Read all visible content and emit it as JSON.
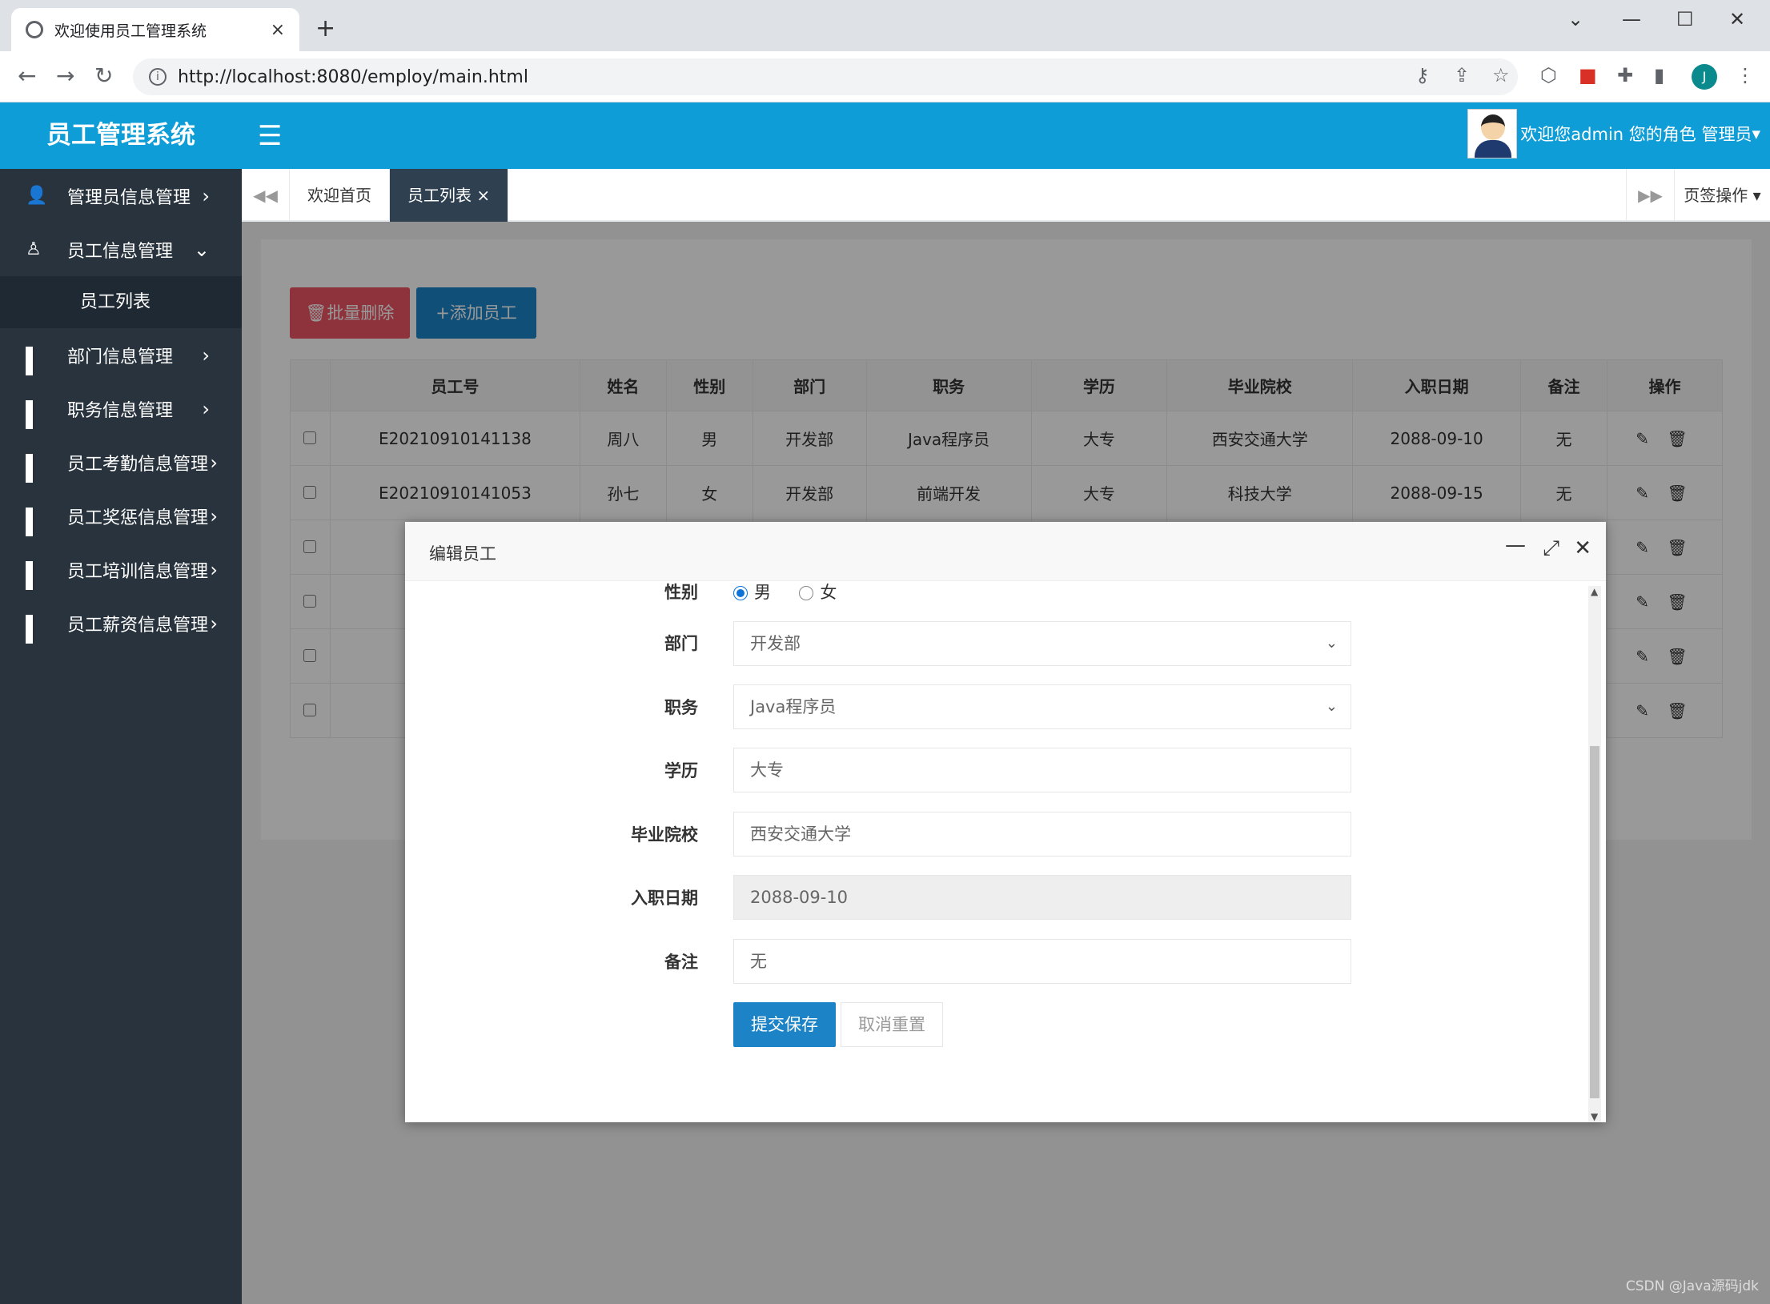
{
  "browser": {
    "tab_title": "欢迎使用员工管理系统",
    "tab_close": "×",
    "new_tab": "+",
    "url": "http://localhost:8080/employ/main.html",
    "profile_initial": "J"
  },
  "header": {
    "logo": "员工管理系统",
    "menu_toggle": "☰",
    "welcome": "欢迎您admin 您的角色 管理员"
  },
  "sidebar": {
    "items": [
      {
        "label": "管理员信息管理",
        "arrow": "›"
      },
      {
        "label": "员工信息管理",
        "arrow": "⌄"
      },
      {
        "label": "员工列表"
      },
      {
        "label": "部门信息管理",
        "arrow": "›"
      },
      {
        "label": "职务信息管理",
        "arrow": "›"
      },
      {
        "label": "员工考勤信息管理",
        "arrow": "›"
      },
      {
        "label": "员工奖惩信息管理",
        "arrow": "›"
      },
      {
        "label": "员工培训信息管理",
        "arrow": "›"
      },
      {
        "label": "员工薪资信息管理",
        "arrow": "›"
      }
    ]
  },
  "page_tabs": {
    "tabs": [
      {
        "label": "欢迎首页"
      },
      {
        "label": "员工列表",
        "close": "×"
      }
    ],
    "ops_label": "页签操作 ▾"
  },
  "toolbar": {
    "batch_delete": "🗑批量删除",
    "add_employee": "+添加员工"
  },
  "table": {
    "headers": [
      "员工号",
      "姓名",
      "性别",
      "部门",
      "职务",
      "学历",
      "毕业院校",
      "入职日期",
      "备注",
      "操作"
    ],
    "rows": [
      [
        "E20210910141138",
        "周八",
        "男",
        "开发部",
        "Java程序员",
        "大专",
        "西安交通大学",
        "2088-09-10",
        "无"
      ],
      [
        "E20210910141053",
        "孙七",
        "女",
        "开发部",
        "前端开发",
        "大专",
        "科技大学",
        "2088-09-15",
        "无"
      ],
      [
        "E2",
        "",
        "",
        "",
        "",
        "",
        "",
        "",
        ""
      ],
      [
        "E2",
        "",
        "",
        "",
        "",
        "",
        "",
        "",
        ""
      ],
      [
        "E2",
        "",
        "",
        "",
        "",
        "",
        "",
        "",
        ""
      ],
      [
        "E2",
        "",
        "",
        "",
        "",
        "",
        "",
        "",
        ""
      ]
    ],
    "action_icons": "✎ 🗑"
  },
  "modal": {
    "title": "编辑员工",
    "gender_label": "性别",
    "gender_male": "男",
    "gender_female": "女",
    "gender_selected": "男",
    "dept_label": "部门",
    "dept_value": "开发部",
    "job_label": "职务",
    "job_value": "Java程序员",
    "edu_label": "学历",
    "edu_value": "大专",
    "school_label": "毕业院校",
    "school_value": "西安交通大学",
    "date_label": "入职日期",
    "date_value": "2088-09-10",
    "remark_label": "备注",
    "remark_value": "无",
    "save_label": "提交保存",
    "reset_label": "取消重置"
  },
  "watermark": "CSDN @Java源码jdk"
}
